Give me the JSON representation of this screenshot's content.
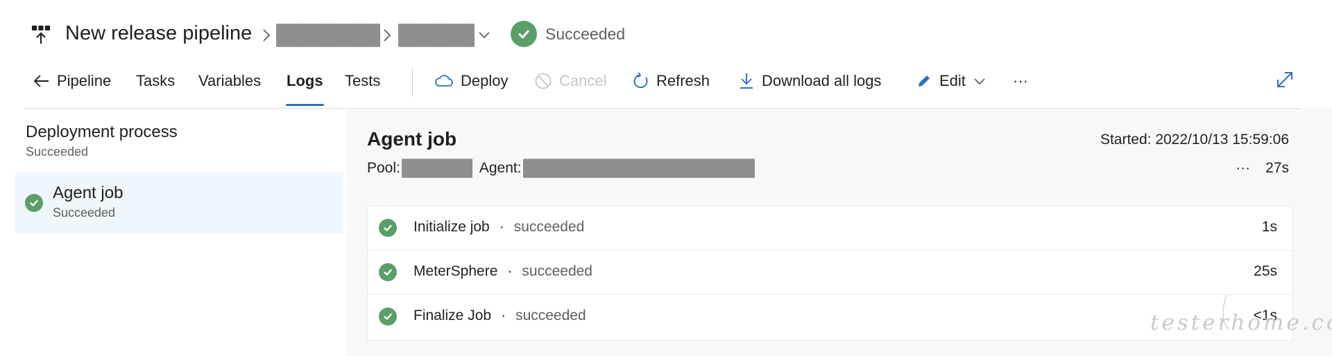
{
  "header": {
    "title": "New release pipeline",
    "status": "Succeeded",
    "breadcrumb_icon": "chevron-right-icon",
    "dropdown_icon": "chevron-down-icon",
    "pipeline_icon": "release-pipeline-icon"
  },
  "toolbar": {
    "back_label": "Pipeline",
    "tabs": [
      "Tasks",
      "Variables",
      "Logs",
      "Tests"
    ],
    "active_tab": "Logs",
    "deploy_label": "Deploy",
    "cancel_label": "Cancel",
    "refresh_label": "Refresh",
    "download_label": "Download all logs",
    "edit_label": "Edit",
    "more_label": "···"
  },
  "sidebar": {
    "title": "Deployment process",
    "status": "Succeeded",
    "items": [
      {
        "label": "Agent job",
        "status": "Succeeded"
      }
    ]
  },
  "main": {
    "title": "Agent job",
    "started_label": "Started: 2022/10/13 15:59:06",
    "pool_label": "Pool:",
    "agent_label": "Agent:",
    "more_label": "···",
    "duration": "27s",
    "steps": [
      {
        "name": "Initialize job",
        "sep": "·",
        "status": "succeeded",
        "duration": "1s"
      },
      {
        "name": "MeterSphere",
        "sep": "·",
        "status": "succeeded",
        "duration": "25s"
      },
      {
        "name": "Finalize Job",
        "sep": "·",
        "status": "succeeded",
        "duration": "<1s"
      }
    ]
  },
  "watermark": {
    "text": "testerhome.com"
  },
  "colors": {
    "success": "#5b9f68",
    "accent": "#2b6fc2",
    "selected_bg": "#eff6fc",
    "muted_text": "#605e5c",
    "disabled_text": "#c8c6c4",
    "main_bg": "#f8f8f8"
  }
}
